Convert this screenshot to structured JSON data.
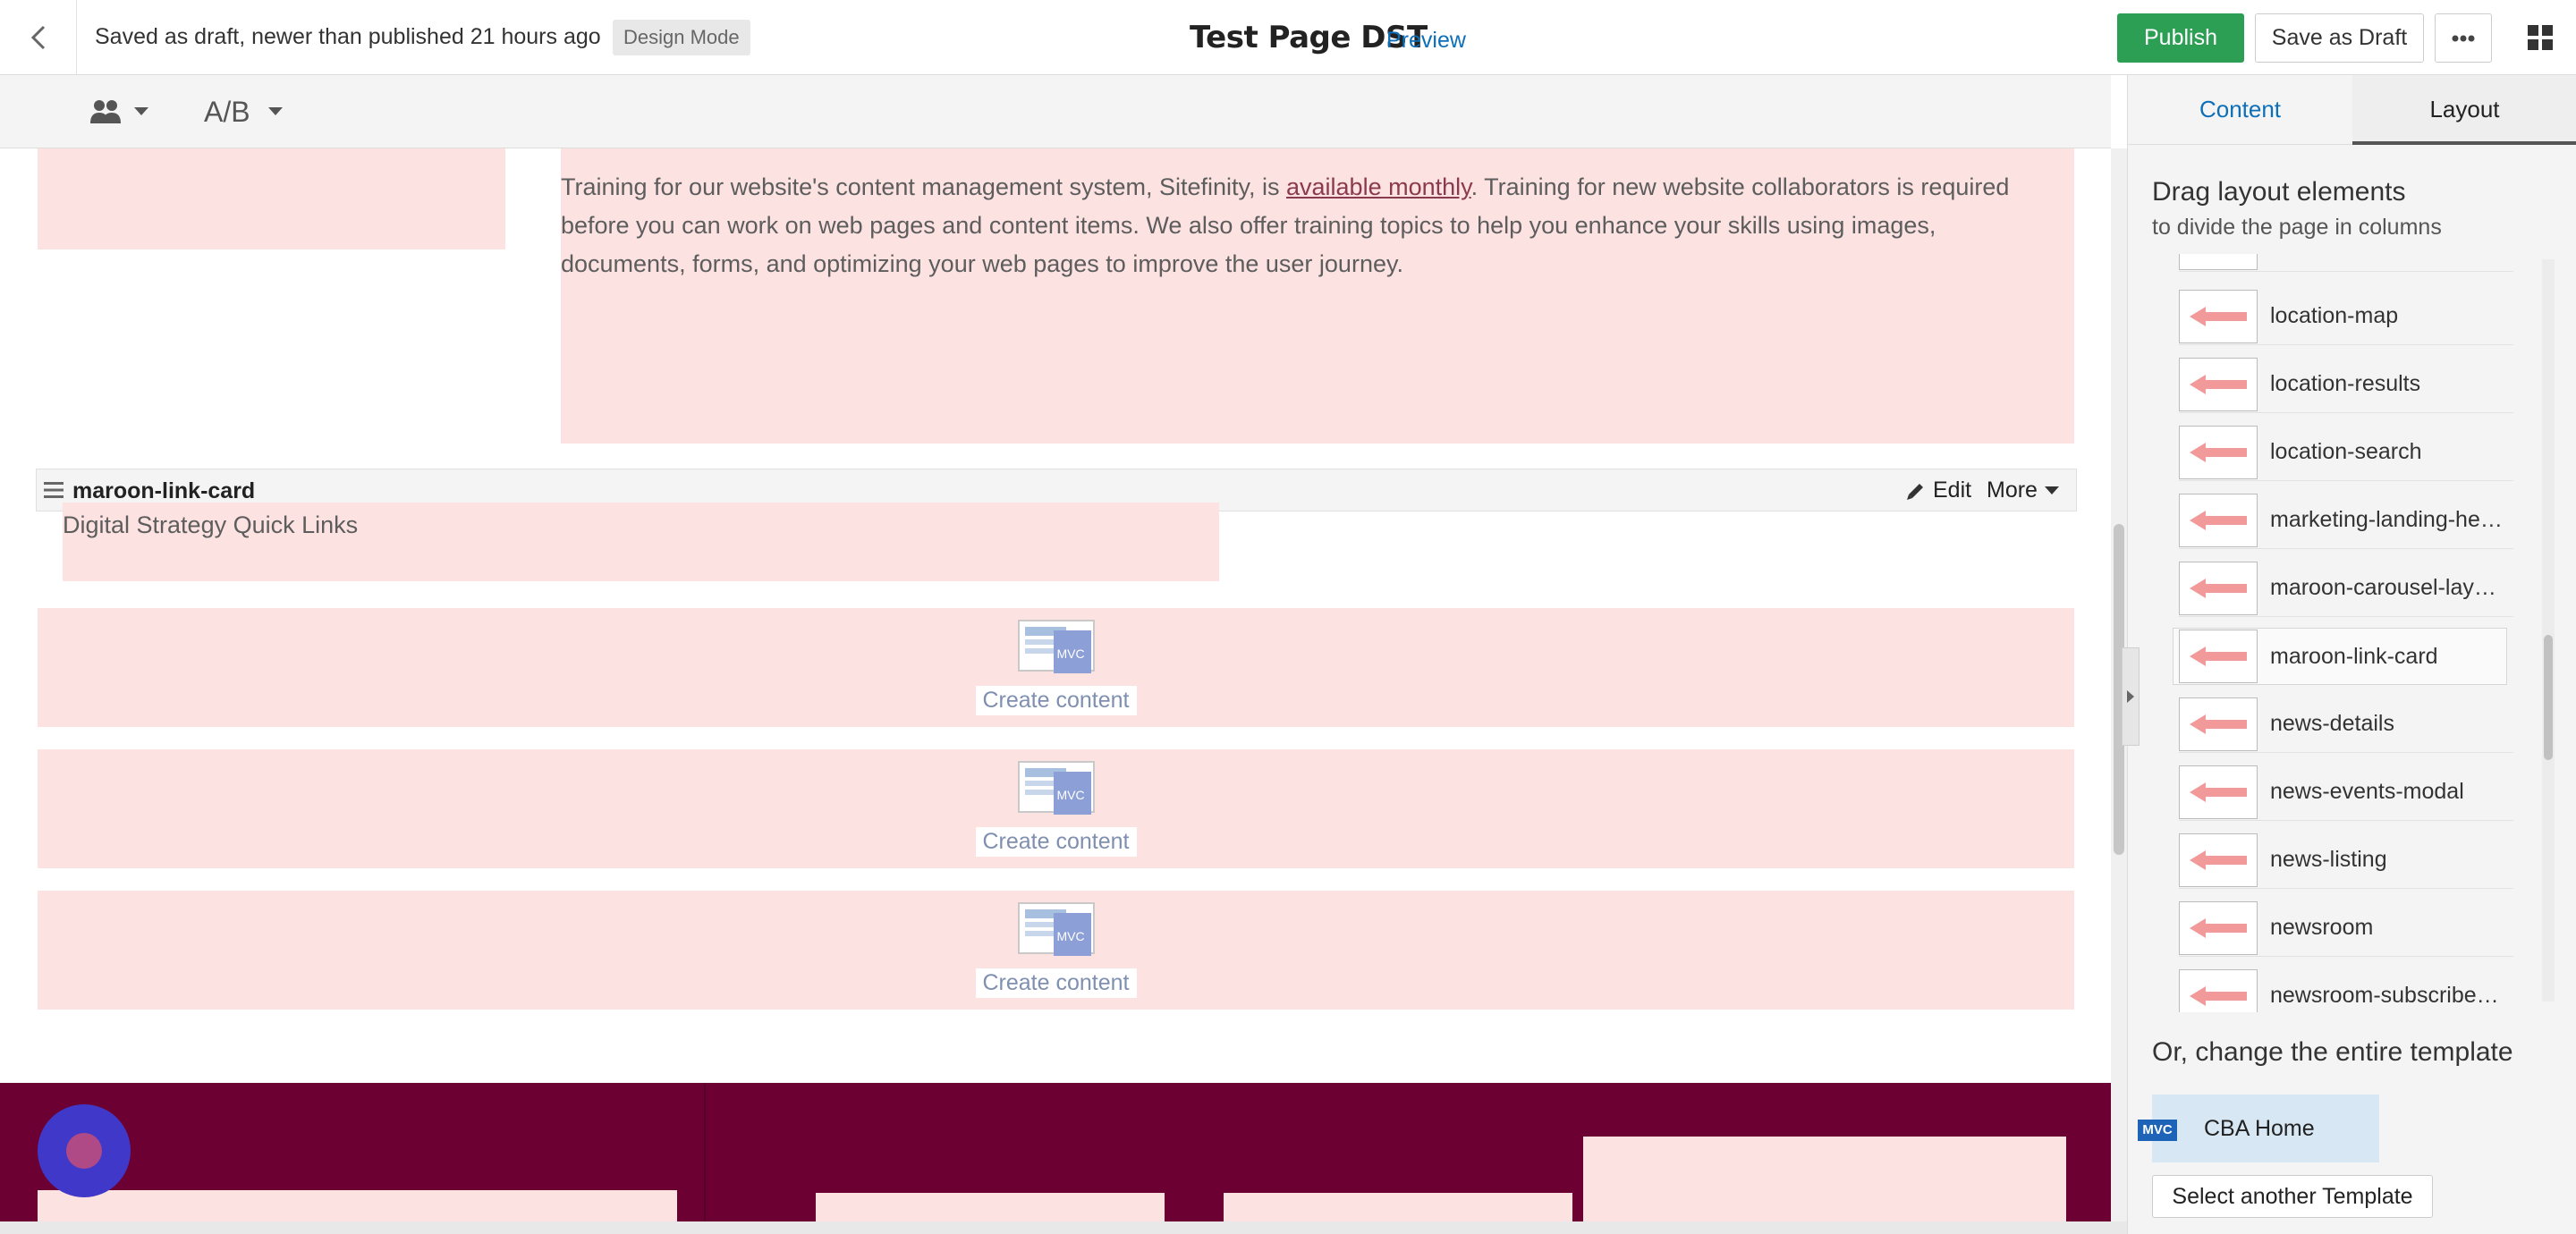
{
  "topbar": {
    "status": "Saved as draft, newer than published 21 hours ago",
    "mode_badge": "Design Mode",
    "page_title": "Test Page DST",
    "preview_label": "Preview",
    "publish_label": "Publish",
    "save_draft_label": "Save as Draft",
    "more_icon": "ellipsis-icon",
    "apps_icon": "grid-icon",
    "back_icon": "chevron-left-icon",
    "publish_color": "#2d9f54"
  },
  "toolbar": {
    "personas_icon": "users-icon",
    "ab_label": "A/B"
  },
  "canvas": {
    "intro": {
      "before_link": "Training for our website's content management system, Sitefinity, is ",
      "link": "available monthly",
      "after_link": ". Training for new website collaborators is required before you can work on web pages and content items. We also offer training topics to help you enhance your skills using images, documents, forms, and optimizing your web pages to improve the user journey."
    },
    "widget": {
      "name": "maroon-link-card",
      "edit_label": "Edit",
      "more_label": "More",
      "heading": "Digital Strategy Quick Links"
    },
    "create_content_blocks": [
      {
        "icon_tag": "MVC",
        "label": "Create content"
      },
      {
        "icon_tag": "MVC",
        "label": "Create content"
      },
      {
        "icon_tag": "MVC",
        "label": "Create content"
      }
    ],
    "placeholder_color": "#fde2e2",
    "footer_color": "#6c0033"
  },
  "sidebar": {
    "tabs": [
      "Content",
      "Layout"
    ],
    "active_tab": "Layout",
    "heading": "Drag layout elements",
    "subheading": "to divide the page in columns",
    "layout_items": [
      "location-map",
      "location-results",
      "location-search",
      "marketing-landing-he…",
      "maroon-carousel-lay…",
      "maroon-link-card",
      "news-details",
      "news-events-modal",
      "news-listing",
      "newsroom",
      "newsroom-subscribe-…"
    ],
    "selected_item": "maroon-link-card",
    "template_heading": "Or, change the entire template",
    "template": {
      "tag": "MVC",
      "name": "CBA Home"
    },
    "select_template_label": "Select another Template"
  }
}
